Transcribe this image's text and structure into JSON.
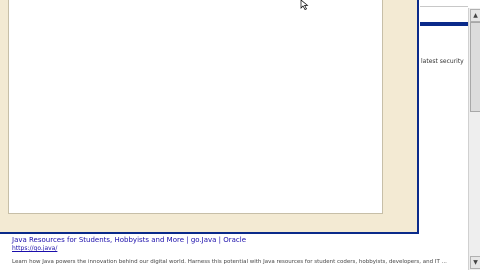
{
  "background_page": {
    "snippet_right": "latest security",
    "result": {
      "title": "Java Resources for Students, Hobbyists and More | go.Java | Oracle",
      "url": "https://go.java/",
      "description": "Learn how Java powers the innovation behind our digital world. Harness this potential with Java resources for student coders, hobbyists, developers, and IT ..."
    }
  },
  "scrollbar": {
    "up_icon": "arrow-up-icon",
    "down_icon": "arrow-down-icon",
    "up_glyph": "▲",
    "down_glyph": "▼"
  },
  "colors": {
    "window_border": "#0a2a8a",
    "window_frame": "#f3ead3",
    "link": "#1a0dab"
  }
}
